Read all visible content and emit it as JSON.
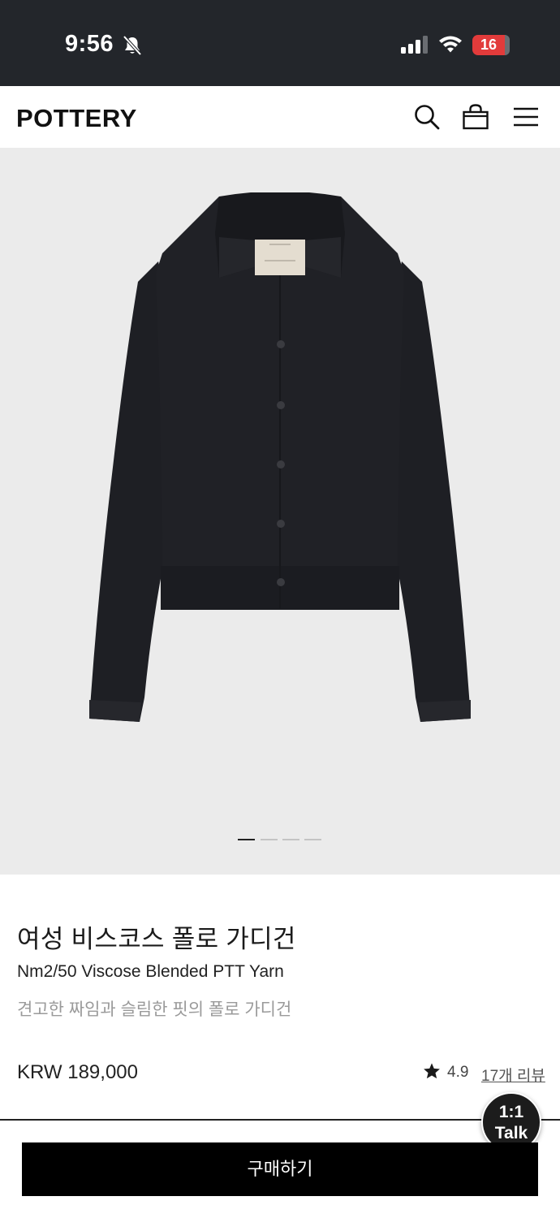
{
  "status_bar": {
    "time": "9:56",
    "battery": "16",
    "icons": [
      "bell-slash-icon",
      "signal-icon",
      "wifi-icon",
      "battery-icon"
    ],
    "battery_color": "#e23b3b"
  },
  "header": {
    "brand": "POTTERY",
    "icons": [
      "search-icon",
      "shopping-bag-icon",
      "menu-icon"
    ]
  },
  "gallery": {
    "image": "black-polo-cardigan",
    "page_indicator": {
      "current": 1,
      "total": 4
    }
  },
  "product": {
    "title": "여성 비스코스 폴로 가디건",
    "subtitle": "Nm2/50 Viscose Blended PTT Yarn",
    "description": "견고한 짜임과 슬림한 핏의 폴로 가디건",
    "price": "KRW 189,000",
    "rating": "4.9",
    "reviews_link": "17개 리뷰"
  },
  "chat": {
    "line1": "1:1",
    "line2": "Talk"
  },
  "buy_button": {
    "label": "구매하기"
  },
  "colors": {
    "accent": "#000000",
    "status_bar_bg": "#23262b",
    "gallery_bg": "#ebebeb"
  }
}
